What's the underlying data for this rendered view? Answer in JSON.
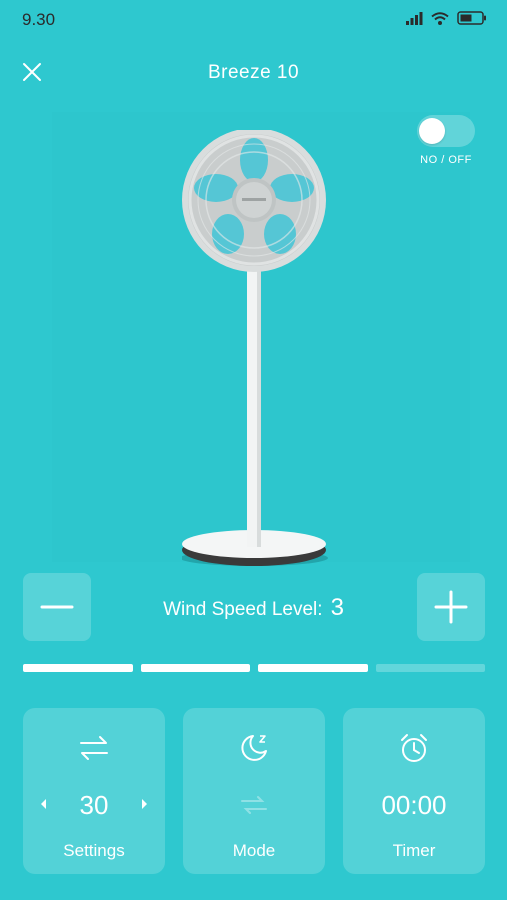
{
  "status_bar": {
    "time": "9.30"
  },
  "header": {
    "title": "Breeze 10"
  },
  "power": {
    "label": "NO / OFF",
    "state": "off"
  },
  "wind_speed": {
    "label": "Wind Speed Level:",
    "value": "3",
    "level": 3,
    "max_level": 4
  },
  "cards": {
    "settings": {
      "value": "30",
      "label": "Settings"
    },
    "mode": {
      "label": "Mode"
    },
    "timer": {
      "value": "00:00",
      "label": "Timer"
    }
  },
  "icons": {
    "close": "close-icon",
    "swap": "swap-arrows-icon",
    "moon": "sleep-moon-icon",
    "alarm": "alarm-clock-icon"
  },
  "colors": {
    "background": "#2ec8cf",
    "foreground": "#ffffff",
    "status_text": "#2b2b2b"
  }
}
